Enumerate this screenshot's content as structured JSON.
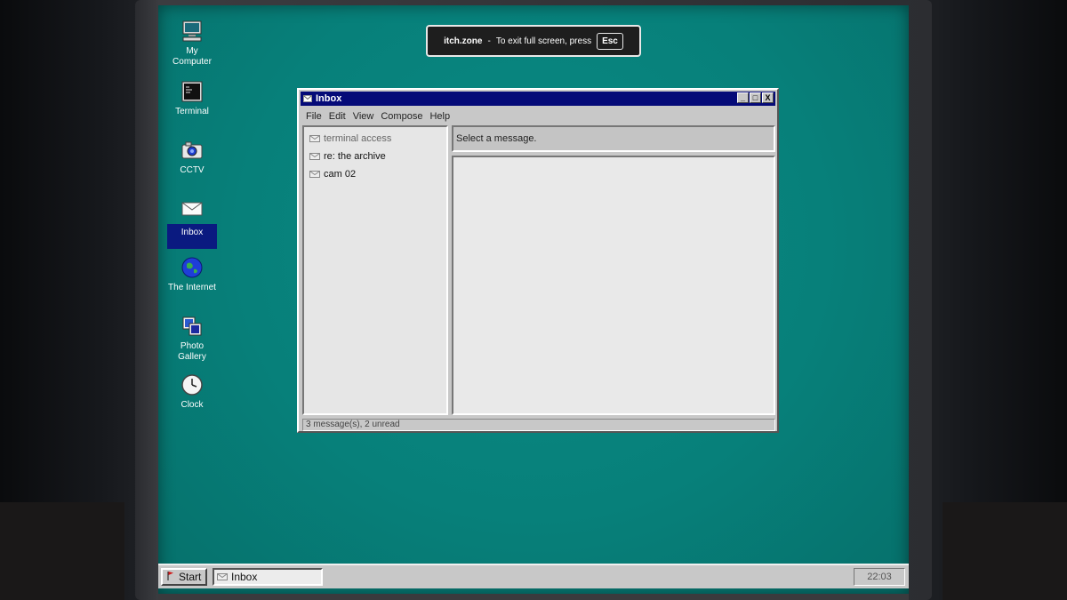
{
  "banner": {
    "site": "itch.zone",
    "separator": "-",
    "message": "To exit full screen, press",
    "key": "Esc"
  },
  "desktop": {
    "icons": [
      {
        "label_line1": "My",
        "label_line2": "Computer",
        "icon": "computer-icon"
      },
      {
        "label_line1": "Terminal",
        "label_line2": "",
        "icon": "terminal-icon"
      },
      {
        "label_line1": "CCTV",
        "label_line2": "",
        "icon": "camera-icon"
      },
      {
        "label_line1": "Inbox",
        "label_line2": "",
        "icon": "envelope-icon"
      },
      {
        "label_line1": "The Internet",
        "label_line2": "",
        "icon": "globe-icon"
      },
      {
        "label_line1": "Photo",
        "label_line2": "Gallery",
        "icon": "gallery-icon"
      },
      {
        "label_line1": "Clock",
        "label_line2": "",
        "icon": "clock-icon"
      }
    ],
    "selected": "Inbox"
  },
  "window": {
    "title": "Inbox",
    "buttons": {
      "minimize": "_",
      "maximize": "□",
      "close": "X"
    },
    "menu": [
      "File",
      "Edit",
      "View",
      "Compose",
      "Help"
    ],
    "messages": [
      {
        "subject": "terminal access",
        "status": "read"
      },
      {
        "subject": "re: the archive",
        "status": "unread"
      },
      {
        "subject": "cam 02",
        "status": "unread"
      }
    ],
    "preview_header": "Select a message.",
    "status": "3 message(s), 2 unread"
  },
  "taskbar": {
    "start_label": "Start",
    "tasks": [
      {
        "label": "Inbox"
      }
    ],
    "clock": "22:03"
  },
  "colors": {
    "desktop": "#07807a",
    "titlebar": "#050a78",
    "selection": "#0a1a80",
    "chrome": "#c8c8c8"
  }
}
